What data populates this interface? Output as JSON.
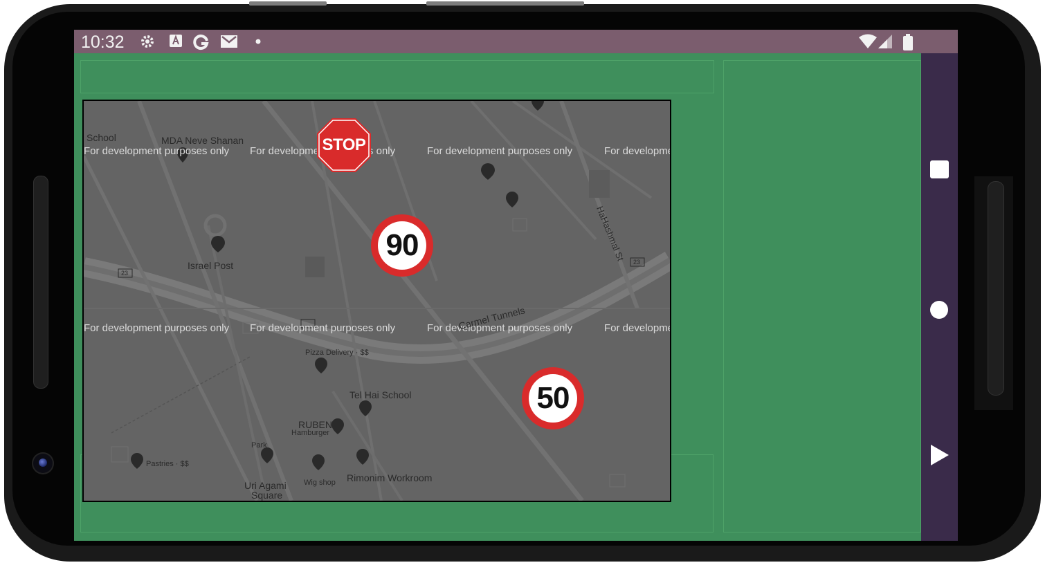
{
  "status_bar": {
    "time": "10:32",
    "icons": [
      "gear-icon",
      "a-icon",
      "g-icon",
      "gmail-icon",
      "dot-icon",
      "wifi-icon",
      "signal-icon",
      "battery-icon"
    ]
  },
  "map": {
    "watermark": "For development purposes only",
    "labels": {
      "school": "School",
      "mda": "MDA Neve Shanan",
      "israel_post": "Israel Post",
      "carmel_tunnels": "Carmel Tunnels",
      "pizza": "Pizza Delivery · $$",
      "tel_hai": "Tel Hai School",
      "ruben": "RUBEN",
      "ruben_sub": "Hamburger",
      "park": "Park",
      "pastries": "Pastries · $$",
      "uri_agami": "Uri Agami",
      "uri_square": "Square",
      "wig_shop": "Wig shop",
      "rimonim": "Rimonim Workroom",
      "hahashmal": "HaHashmal St",
      "route_23": "23"
    },
    "signs": {
      "stop": "STOP",
      "speed_90": "90",
      "speed_50": "50"
    }
  },
  "nav": {
    "items": [
      "recents-button",
      "home-button",
      "back-button"
    ]
  },
  "colors": {
    "screen_bg": "#3f8f5c",
    "status_bar": "#7b5d6e",
    "nav_bar": "#3a2b4a",
    "map_bg": "#646464",
    "sign_red": "#d92b2b"
  }
}
